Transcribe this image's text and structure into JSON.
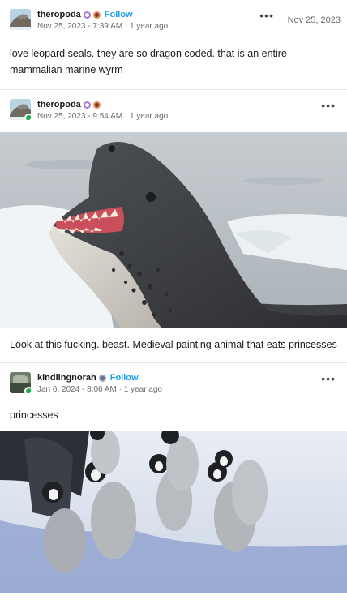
{
  "posts": [
    {
      "author": "theropoda",
      "follow": "Follow",
      "timestamp": "Nov 25, 2023 - 7:39 AM · 1 year ago",
      "date": "Nov 25, 2023",
      "text": "love leopard seals. they are so dragon coded. that is an entire mammalian marine wyrm"
    },
    {
      "author": "theropoda",
      "timestamp": "Nov 25, 2023 - 9:54 AM · 1 year ago",
      "text": "Look at this fucking. beast. Medieval painting animal that eats princesses"
    },
    {
      "author": "kindlingnorah",
      "follow": "Follow",
      "timestamp": "Jan 6, 2024 - 8:06 AM · 1 year ago",
      "text": "princesses"
    }
  ],
  "icons": {
    "more": "more-options-icon",
    "avatar": "avatar-icon",
    "badge": "badge-icon"
  },
  "colors": {
    "follow": "#1da1f2",
    "online": "#19b34a",
    "divider": "#e6e6e6"
  }
}
